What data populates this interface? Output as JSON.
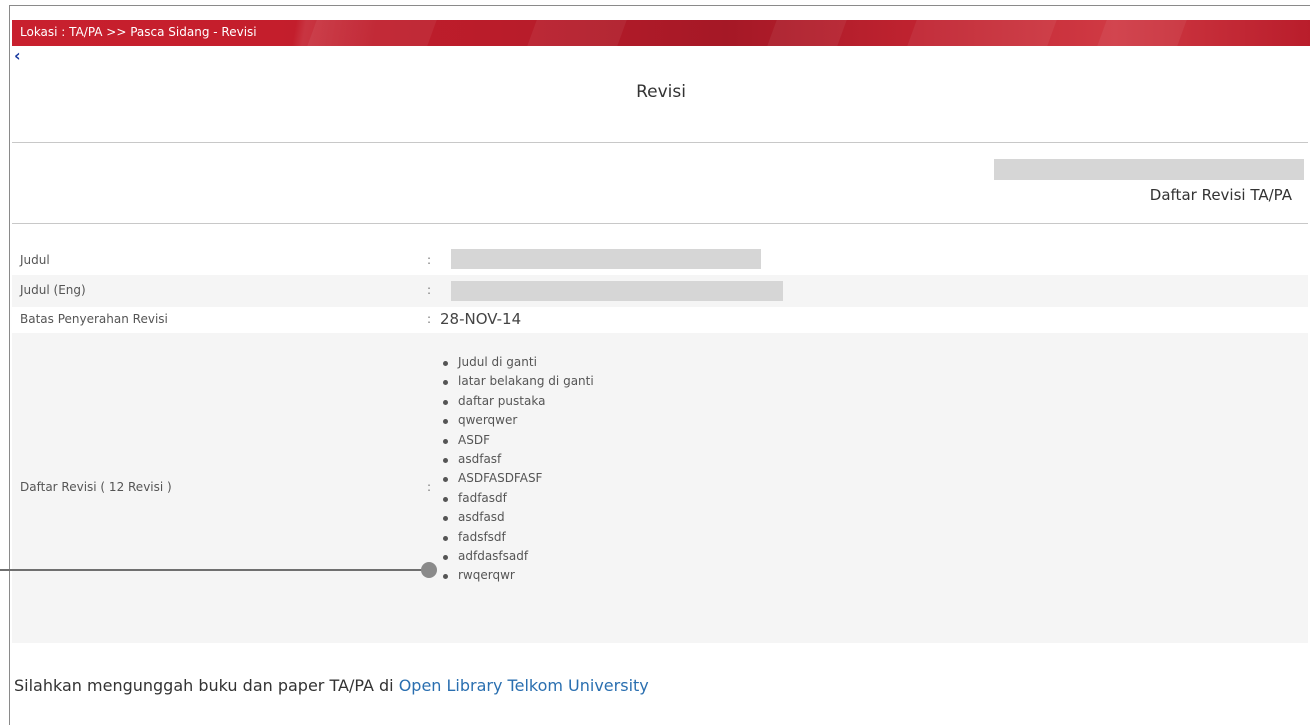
{
  "header": {
    "location": "Lokasi : TA/PA >> Pasca Sidang - Revisi"
  },
  "nav": {
    "back_icon": "chevron-left-icon",
    "back_glyph": "‹"
  },
  "page": {
    "title": "Revisi",
    "subtitle": "Daftar Revisi TA/PA"
  },
  "fields": {
    "judul_label": "Judul",
    "judul_eng_label": "Judul (Eng)",
    "batas_label": "Batas Penyerahan Revisi",
    "batas_value": "28-NOV-14",
    "daftar_label": "Daftar Revisi ( 12 Revisi )",
    "colon": ":"
  },
  "revisions": [
    "Judul di ganti",
    "latar belakang di ganti",
    "daftar pustaka",
    "qwerqwer",
    "ASDF",
    "asdfasf",
    "ASDFASDFASF",
    "fadfasdf",
    "asdfasd",
    "fadsfsdf",
    "adfdasfsadf",
    "rwqerqwr"
  ],
  "footer": {
    "text": "Silahkan mengunggah buku dan paper TA/PA di ",
    "link": "Open Library Telkom University"
  },
  "colors": {
    "header_red": "#c41e2c",
    "link_blue": "#2a6fb0",
    "redacted_grey": "#d6d6d6"
  }
}
